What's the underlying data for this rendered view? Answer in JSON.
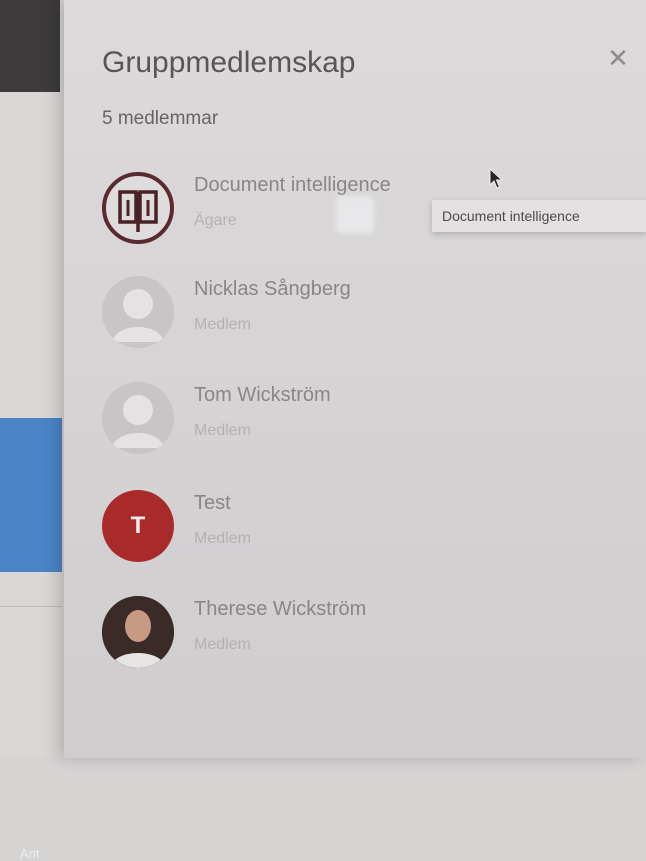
{
  "background": {
    "left_button_label": "Ant"
  },
  "panel": {
    "title": "Gruppmedlemskap",
    "member_count": "5 medlemmar",
    "close_icon": "close-icon"
  },
  "members": [
    {
      "name": "Document intelligence",
      "role": "Ägare",
      "avatar": "book-icon"
    },
    {
      "name": "Nicklas Sångberg",
      "role": "Medlem",
      "avatar": "person-icon"
    },
    {
      "name": "Tom Wickström",
      "role": "Medlem",
      "avatar": "person-icon"
    },
    {
      "name": "Test",
      "role": "Medlem",
      "avatar": "letter",
      "initial": "T"
    },
    {
      "name": "Therese Wickström",
      "role": "Medlem",
      "avatar": "photo"
    }
  ],
  "tooltip": {
    "text": "Document intelligence"
  },
  "colors": {
    "accent_blue": "#4a84c6",
    "test_avatar": "#a82a2b",
    "owner_icon": "#5a2a2e"
  }
}
